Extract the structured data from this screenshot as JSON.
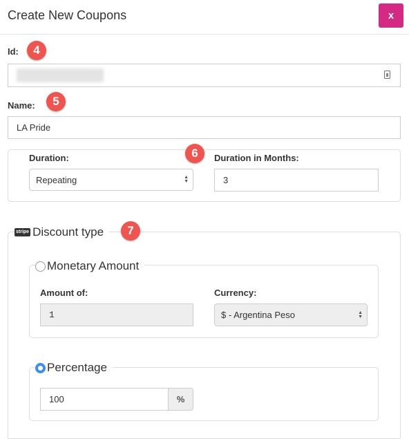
{
  "header": {
    "title": "Create New Coupons",
    "close_label": "x"
  },
  "annotations": [
    "4",
    "5",
    "6",
    "7"
  ],
  "id_field": {
    "label": "Id:",
    "value_redacted": true,
    "icon": "contact-card-icon"
  },
  "name_field": {
    "label": "Name:",
    "value": "LA Pride"
  },
  "duration": {
    "label": "Duration:",
    "selected": "Repeating",
    "months_label": "Duration in Months:",
    "months_value": "3"
  },
  "discount_type": {
    "legend": "Discount type",
    "brand_icon": "stripe",
    "monetary": {
      "legend": "Monetary Amount",
      "checked": false,
      "amount_label": "Amount of:",
      "amount_value": "1",
      "currency_label": "Currency:",
      "currency_selected": "$ - Argentina Peso"
    },
    "percentage": {
      "legend": "Percentage",
      "checked": true,
      "value": "100",
      "suffix": "%"
    }
  },
  "colors": {
    "close_button": "#d52a84",
    "badge": "#f0544f",
    "radio_checked": "#3b8ff3"
  }
}
